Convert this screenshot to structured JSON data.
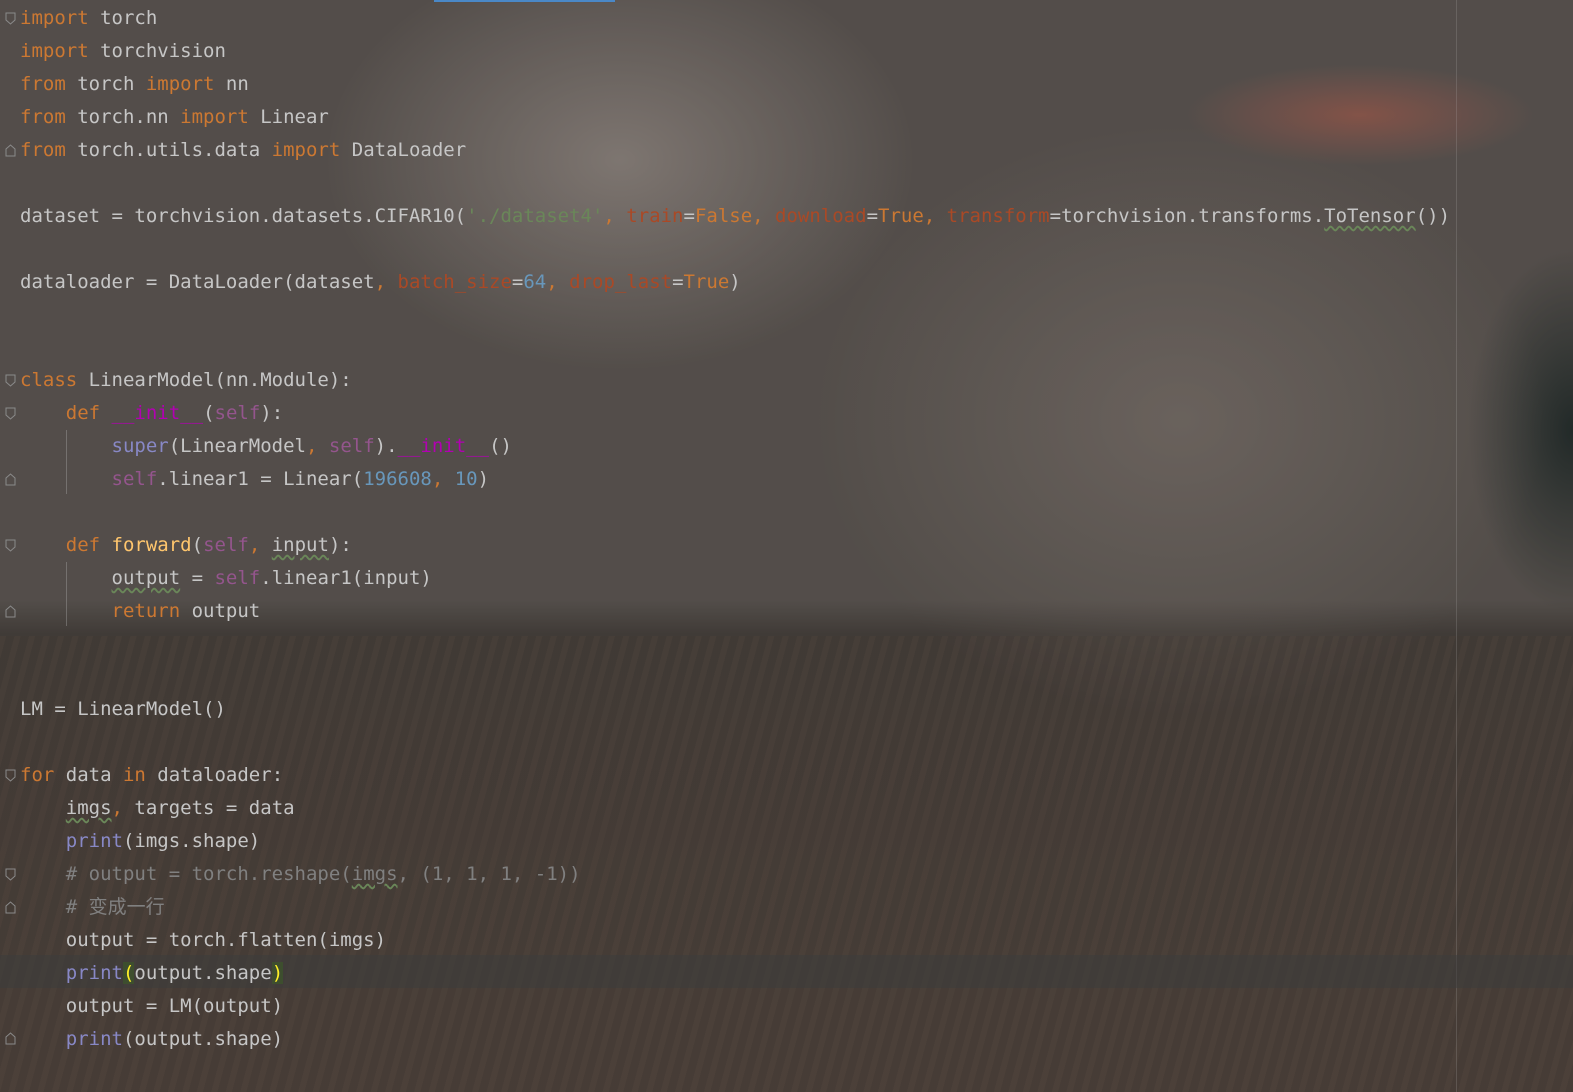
{
  "editor": {
    "lines": {
      "l1": {
        "a": "import",
        "b": " torch"
      },
      "l2": {
        "a": "import",
        "b": " torchvision"
      },
      "l3": {
        "a": "from",
        "b": " torch ",
        "c": "import",
        "d": " nn"
      },
      "l4": {
        "a": "from",
        "b": " torch.nn ",
        "c": "import",
        "d": " Linear"
      },
      "l5": {
        "a": "from",
        "b": " torch.utils.data ",
        "c": "import",
        "d": " DataLoader"
      },
      "l6": {
        "a": "dataset = torchvision.datasets.CIFAR10(",
        "b": "'./dataset4'",
        "c": ", ",
        "d": "train",
        "e": "=",
        "f": "False",
        "g": ", ",
        "h": "download",
        "i": "=",
        "j": "True",
        "k": ", ",
        "l": "transform",
        "m": "=torchvision.transforms.",
        "n": "ToTensor",
        "o": "())"
      },
      "l7": {
        "a": "dataloader = DataLoader(dataset",
        "b": ", ",
        "c": "batch_size",
        "d": "=",
        "e": "64",
        "f": ", ",
        "g": "drop_last",
        "h": "=",
        "i": "True",
        "j": ")"
      },
      "l8": {
        "a": "class",
        "b": " LinearModel(nn.Module):"
      },
      "l9": {
        "a": "    ",
        "b": "def",
        "c": " ",
        "d": "__init__",
        "e": "(",
        "f": "self",
        "g": "):"
      },
      "l10": {
        "a": "        ",
        "b": "super",
        "c": "(LinearModel",
        ", ": "",
        "d": ", ",
        "e": "self",
        "f": ").",
        "g": "__init__",
        "h": "()"
      },
      "l11": {
        "a": "        ",
        "b": "self",
        "c": ".linear1 = Linear(",
        "d": "196608",
        "e": ", ",
        "f": "10",
        "g": ")"
      },
      "l12": {
        "a": "    ",
        "b": "def",
        "c": " ",
        "d": "forward",
        "e": "(",
        "f": "self",
        "g": ", ",
        "h": "input",
        "i": "):"
      },
      "l13": {
        "a": "        ",
        "b": "output",
        "c": " = ",
        "d": "self",
        "e": ".linear1(input)"
      },
      "l14": {
        "a": "        ",
        "b": "return",
        "c": " output"
      },
      "l15": {
        "a": "LM = LinearModel()"
      },
      "l16": {
        "a": "for",
        "b": " data ",
        "c": "in",
        "d": " dataloader:"
      },
      "l17": {
        "a": "    ",
        "b": "imgs",
        "c": ", ",
        "d": "targets = data"
      },
      "l18": {
        "a": "    ",
        "b": "print",
        "c": "(imgs.shape)"
      },
      "l19": {
        "a": "    ",
        "b": "# output = torch.reshape(",
        "c": "imgs",
        "d": ", (1, 1, 1, -1))"
      },
      "l20": {
        "a": "    ",
        "b": "# 变成一行"
      },
      "l21": {
        "a": "    ",
        "b": "output = torch.flatten(imgs)"
      },
      "l22": {
        "a": "    ",
        "b": "print",
        "c": "(",
        "d": "output.shape",
        "e": ")"
      },
      "l23": {
        "a": "    ",
        "b": "output = LM(output)"
      },
      "l24": {
        "a": "    ",
        "b": "print",
        "c": "(output.shape)"
      }
    }
  },
  "colors": {
    "keyword": "#cc7832",
    "string": "#6a8759",
    "number": "#6897bb",
    "param": "#aa4926",
    "self": "#94558d",
    "magic": "#b200b2",
    "builtin": "#8888c6",
    "function": "#ffc66d",
    "comment": "#808080",
    "text": "#c6c6c6"
  },
  "icons": {
    "fold": "fold-marker-icon"
  }
}
